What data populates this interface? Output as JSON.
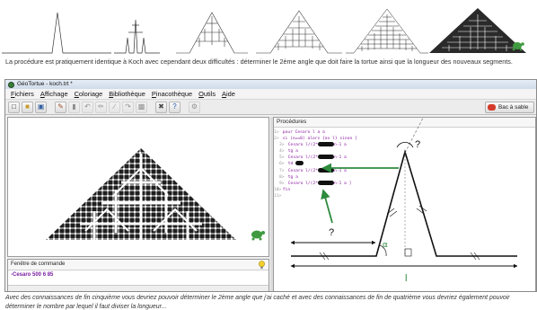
{
  "intro_text": "La procédure est pratiquement identique à Koch avec cependant deux difficultés : déterminer le 2ème angle que doit faire la tortue ainsi que la longueur des nouveaux segments.",
  "caption_text": "Avec des connaissances de fin cinquième vous devriez pouvoir déterminer le 2ème angle que j'ai caché et avec des connaissances de fin de quatrième vous devriez également pouvoir déterminer le nombre par lequel il faut diviser la longueur...",
  "window": {
    "title": "GéoTortue - koch.trt *",
    "menu": [
      "Fichiers",
      "Affichage",
      "Coloriage",
      "Bibliothèque",
      "Pinacothèque",
      "Outils",
      "Aide"
    ],
    "bac_label": "Bac à sable"
  },
  "command_pane": {
    "title": "Fenêtre de commande",
    "command": "Cesaro 500 6 85"
  },
  "procedures": {
    "title": "Procédures",
    "lines": [
      {
        "n": "1>",
        "t": "pour Cesaro l a a"
      },
      {
        "n": "2>",
        "t": "si (n==0) alors {av l} sinon ["
      },
      {
        "n": "3>",
        "t": "Cesaro l/(2*",
        "t2": "n-1 a"
      },
      {
        "n": "4>",
        "t": "tg a"
      },
      {
        "n": "5>",
        "t": "Cesaro l/(2*",
        "t2": "n-1 a"
      },
      {
        "n": "6>",
        "t": "td"
      },
      {
        "n": "7>",
        "t": "Cesaro l/(2*",
        "t2": "n-1 a"
      },
      {
        "n": "8>",
        "t": "tg a"
      },
      {
        "n": "9>",
        "t": "Cesaro l/(2*",
        "t2": "n-1 a ]"
      },
      {
        "n": "10>",
        "t": "fin"
      },
      {
        "n": "11>",
        "t": ""
      }
    ]
  },
  "diagram": {
    "question_marks": [
      "?",
      "?"
    ],
    "alpha": "α",
    "length_label": "l"
  },
  "colors": {
    "fractal": "#2b2b2b",
    "arrow_green": "#2e8b3e",
    "turtle_green": "#3f9a3f"
  }
}
